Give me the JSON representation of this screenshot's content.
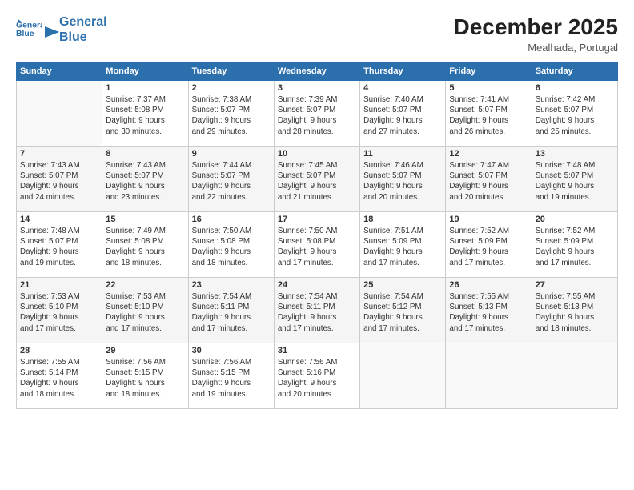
{
  "header": {
    "logo_line1": "General",
    "logo_line2": "Blue",
    "month_title": "December 2025",
    "location": "Mealhada, Portugal"
  },
  "weekdays": [
    "Sunday",
    "Monday",
    "Tuesday",
    "Wednesday",
    "Thursday",
    "Friday",
    "Saturday"
  ],
  "weeks": [
    [
      {
        "day": "",
        "info": ""
      },
      {
        "day": "1",
        "info": "Sunrise: 7:37 AM\nSunset: 5:08 PM\nDaylight: 9 hours\nand 30 minutes."
      },
      {
        "day": "2",
        "info": "Sunrise: 7:38 AM\nSunset: 5:07 PM\nDaylight: 9 hours\nand 29 minutes."
      },
      {
        "day": "3",
        "info": "Sunrise: 7:39 AM\nSunset: 5:07 PM\nDaylight: 9 hours\nand 28 minutes."
      },
      {
        "day": "4",
        "info": "Sunrise: 7:40 AM\nSunset: 5:07 PM\nDaylight: 9 hours\nand 27 minutes."
      },
      {
        "day": "5",
        "info": "Sunrise: 7:41 AM\nSunset: 5:07 PM\nDaylight: 9 hours\nand 26 minutes."
      },
      {
        "day": "6",
        "info": "Sunrise: 7:42 AM\nSunset: 5:07 PM\nDaylight: 9 hours\nand 25 minutes."
      }
    ],
    [
      {
        "day": "7",
        "info": "Sunrise: 7:43 AM\nSunset: 5:07 PM\nDaylight: 9 hours\nand 24 minutes."
      },
      {
        "day": "8",
        "info": "Sunrise: 7:43 AM\nSunset: 5:07 PM\nDaylight: 9 hours\nand 23 minutes."
      },
      {
        "day": "9",
        "info": "Sunrise: 7:44 AM\nSunset: 5:07 PM\nDaylight: 9 hours\nand 22 minutes."
      },
      {
        "day": "10",
        "info": "Sunrise: 7:45 AM\nSunset: 5:07 PM\nDaylight: 9 hours\nand 21 minutes."
      },
      {
        "day": "11",
        "info": "Sunrise: 7:46 AM\nSunset: 5:07 PM\nDaylight: 9 hours\nand 20 minutes."
      },
      {
        "day": "12",
        "info": "Sunrise: 7:47 AM\nSunset: 5:07 PM\nDaylight: 9 hours\nand 20 minutes."
      },
      {
        "day": "13",
        "info": "Sunrise: 7:48 AM\nSunset: 5:07 PM\nDaylight: 9 hours\nand 19 minutes."
      }
    ],
    [
      {
        "day": "14",
        "info": "Sunrise: 7:48 AM\nSunset: 5:07 PM\nDaylight: 9 hours\nand 19 minutes."
      },
      {
        "day": "15",
        "info": "Sunrise: 7:49 AM\nSunset: 5:08 PM\nDaylight: 9 hours\nand 18 minutes."
      },
      {
        "day": "16",
        "info": "Sunrise: 7:50 AM\nSunset: 5:08 PM\nDaylight: 9 hours\nand 18 minutes."
      },
      {
        "day": "17",
        "info": "Sunrise: 7:50 AM\nSunset: 5:08 PM\nDaylight: 9 hours\nand 17 minutes."
      },
      {
        "day": "18",
        "info": "Sunrise: 7:51 AM\nSunset: 5:09 PM\nDaylight: 9 hours\nand 17 minutes."
      },
      {
        "day": "19",
        "info": "Sunrise: 7:52 AM\nSunset: 5:09 PM\nDaylight: 9 hours\nand 17 minutes."
      },
      {
        "day": "20",
        "info": "Sunrise: 7:52 AM\nSunset: 5:09 PM\nDaylight: 9 hours\nand 17 minutes."
      }
    ],
    [
      {
        "day": "21",
        "info": "Sunrise: 7:53 AM\nSunset: 5:10 PM\nDaylight: 9 hours\nand 17 minutes."
      },
      {
        "day": "22",
        "info": "Sunrise: 7:53 AM\nSunset: 5:10 PM\nDaylight: 9 hours\nand 17 minutes."
      },
      {
        "day": "23",
        "info": "Sunrise: 7:54 AM\nSunset: 5:11 PM\nDaylight: 9 hours\nand 17 minutes."
      },
      {
        "day": "24",
        "info": "Sunrise: 7:54 AM\nSunset: 5:11 PM\nDaylight: 9 hours\nand 17 minutes."
      },
      {
        "day": "25",
        "info": "Sunrise: 7:54 AM\nSunset: 5:12 PM\nDaylight: 9 hours\nand 17 minutes."
      },
      {
        "day": "26",
        "info": "Sunrise: 7:55 AM\nSunset: 5:13 PM\nDaylight: 9 hours\nand 17 minutes."
      },
      {
        "day": "27",
        "info": "Sunrise: 7:55 AM\nSunset: 5:13 PM\nDaylight: 9 hours\nand 18 minutes."
      }
    ],
    [
      {
        "day": "28",
        "info": "Sunrise: 7:55 AM\nSunset: 5:14 PM\nDaylight: 9 hours\nand 18 minutes."
      },
      {
        "day": "29",
        "info": "Sunrise: 7:56 AM\nSunset: 5:15 PM\nDaylight: 9 hours\nand 18 minutes."
      },
      {
        "day": "30",
        "info": "Sunrise: 7:56 AM\nSunset: 5:15 PM\nDaylight: 9 hours\nand 19 minutes."
      },
      {
        "day": "31",
        "info": "Sunrise: 7:56 AM\nSunset: 5:16 PM\nDaylight: 9 hours\nand 20 minutes."
      },
      {
        "day": "",
        "info": ""
      },
      {
        "day": "",
        "info": ""
      },
      {
        "day": "",
        "info": ""
      }
    ]
  ]
}
